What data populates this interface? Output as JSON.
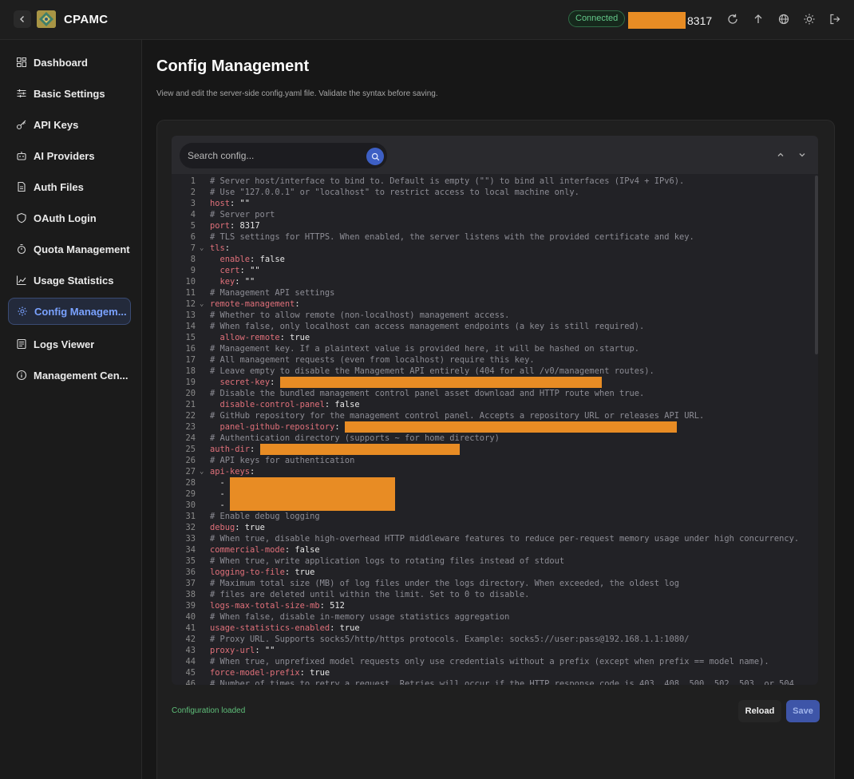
{
  "app": {
    "title": "CPAMC",
    "status": "Connected",
    "port_suffix": "8317"
  },
  "colors": {
    "accent": "#7aa2ff",
    "connected": "#64c98a",
    "redaction": "#e88c24",
    "yaml_key": "#e0707a",
    "comment": "#8d8d95"
  },
  "header_icons": [
    "refresh-icon",
    "upload-icon",
    "globe-icon",
    "theme-sun-icon",
    "logout-icon"
  ],
  "sidebar": {
    "items": [
      {
        "label": "Dashboard",
        "icon": "dashboard-icon"
      },
      {
        "label": "Basic Settings",
        "icon": "sliders-icon"
      },
      {
        "label": "API Keys",
        "icon": "key-icon"
      },
      {
        "label": "AI Providers",
        "icon": "robot-icon"
      },
      {
        "label": "Auth Files",
        "icon": "file-icon"
      },
      {
        "label": "OAuth Login",
        "icon": "shield-icon"
      },
      {
        "label": "Quota Management",
        "icon": "timer-icon"
      },
      {
        "label": "Usage Statistics",
        "icon": "chart-icon"
      },
      {
        "label": "Config Managem...",
        "icon": "gear-icon",
        "active": true
      },
      {
        "label": "Logs Viewer",
        "icon": "logs-icon"
      },
      {
        "label": "Management Cen...",
        "icon": "info-icon"
      }
    ]
  },
  "page": {
    "title": "Config Management",
    "description": "View and edit the server-side config.yaml file. Validate the syntax before saving."
  },
  "editor": {
    "search_placeholder": "Search config...",
    "lines": [
      {
        "n": "1",
        "t": "c",
        "text": "# Server host/interface to bind to. Default is empty (\"\") to bind all interfaces (IPv4 + IPv6)."
      },
      {
        "n": "2",
        "t": "c",
        "text": "# Use \"127.0.0.1\" or \"localhost\" to restrict access to local machine only."
      },
      {
        "n": "3",
        "t": "kv",
        "key": "host",
        "val": " \"\""
      },
      {
        "n": "4",
        "t": "c",
        "text": "# Server port"
      },
      {
        "n": "5",
        "t": "kv",
        "key": "port",
        "val": " 8317"
      },
      {
        "n": "6",
        "t": "c",
        "text": "# TLS settings for HTTPS. When enabled, the server listens with the provided certificate and key."
      },
      {
        "n": "7",
        "t": "kv",
        "key": "tls",
        "val": "",
        "fold": true
      },
      {
        "n": "8",
        "t": "kv",
        "key": "  enable",
        "val": " false"
      },
      {
        "n": "9",
        "t": "kv",
        "key": "  cert",
        "val": " \"\""
      },
      {
        "n": "10",
        "t": "kv",
        "key": "  key",
        "val": " \"\""
      },
      {
        "n": "11",
        "t": "c",
        "text": "# Management API settings"
      },
      {
        "n": "12",
        "t": "kv",
        "key": "remote-management",
        "val": "",
        "fold": true
      },
      {
        "n": "13",
        "t": "c",
        "text": "# Whether to allow remote (non-localhost) management access."
      },
      {
        "n": "14",
        "t": "c",
        "text": "# When false, only localhost can access management endpoints (a key is still required)."
      },
      {
        "n": "15",
        "t": "kv",
        "key": "  allow-remote",
        "val": " true"
      },
      {
        "n": "16",
        "t": "c",
        "text": "# Management key. If a plaintext value is provided here, it will be hashed on startup."
      },
      {
        "n": "17",
        "t": "c",
        "text": "# All management requests (even from localhost) require this key."
      },
      {
        "n": "18",
        "t": "c",
        "text": "# Leave empty to disable the Management API entirely (404 for all /v0/management routes)."
      },
      {
        "n": "19",
        "t": "kv",
        "key": "  secret-key",
        "val": " ",
        "redact": 403
      },
      {
        "n": "20",
        "t": "c",
        "text": "# Disable the bundled management control panel asset download and HTTP route when true."
      },
      {
        "n": "21",
        "t": "kv",
        "key": "  disable-control-panel",
        "val": " false"
      },
      {
        "n": "22",
        "t": "c",
        "text": "# GitHub repository for the management control panel. Accepts a repository URL or releases API URL."
      },
      {
        "n": "23",
        "t": "kv",
        "key": "  panel-github-repository",
        "val": " ",
        "redact": 416
      },
      {
        "n": "24",
        "t": "c",
        "text": "# Authentication directory (supports ~ for home directory)"
      },
      {
        "n": "25",
        "t": "kv",
        "key": "auth-dir",
        "val": " ",
        "redact": 250
      },
      {
        "n": "26",
        "t": "c",
        "text": "# API keys for authentication"
      },
      {
        "n": "27",
        "t": "kv",
        "key": "api-keys",
        "val": "",
        "fold": true
      },
      {
        "n": "28",
        "t": "li",
        "text": "  - ",
        "redact": 207
      },
      {
        "n": "29",
        "t": "li",
        "text": "  - ",
        "redact": 207
      },
      {
        "n": "30",
        "t": "li",
        "text": "  - ",
        "redact": 207
      },
      {
        "n": "31",
        "t": "c",
        "text": "# Enable debug logging"
      },
      {
        "n": "32",
        "t": "kv",
        "key": "debug",
        "val": " true"
      },
      {
        "n": "33",
        "t": "c",
        "text": "# When true, disable high-overhead HTTP middleware features to reduce per-request memory usage under high concurrency."
      },
      {
        "n": "34",
        "t": "kv",
        "key": "commercial-mode",
        "val": " false"
      },
      {
        "n": "35",
        "t": "c",
        "text": "# When true, write application logs to rotating files instead of stdout"
      },
      {
        "n": "36",
        "t": "kv",
        "key": "logging-to-file",
        "val": " true"
      },
      {
        "n": "37",
        "t": "c",
        "text": "# Maximum total size (MB) of log files under the logs directory. When exceeded, the oldest log"
      },
      {
        "n": "38",
        "t": "c",
        "text": "# files are deleted until within the limit. Set to 0 to disable."
      },
      {
        "n": "39",
        "t": "kv",
        "key": "logs-max-total-size-mb",
        "val": " 512"
      },
      {
        "n": "40",
        "t": "c",
        "text": "# When false, disable in-memory usage statistics aggregation"
      },
      {
        "n": "41",
        "t": "kv",
        "key": "usage-statistics-enabled",
        "val": " true"
      },
      {
        "n": "42",
        "t": "c",
        "text": "# Proxy URL. Supports socks5/http/https protocols. Example: socks5://user:pass@192.168.1.1:1080/"
      },
      {
        "n": "43",
        "t": "kv",
        "key": "proxy-url",
        "val": " \"\""
      },
      {
        "n": "44",
        "t": "c",
        "text": "# When true, unprefixed model requests only use credentials without a prefix (except when prefix == model name)."
      },
      {
        "n": "45",
        "t": "kv",
        "key": "force-model-prefix",
        "val": " true"
      },
      {
        "n": "46",
        "t": "c",
        "text": "# Number of times to retry a request. Retries will occur if the HTTP response code is 403, 408, 500, 502, 503, or 504."
      }
    ]
  },
  "footer": {
    "status": "Configuration loaded",
    "reload_label": "Reload",
    "save_label": "Save"
  }
}
